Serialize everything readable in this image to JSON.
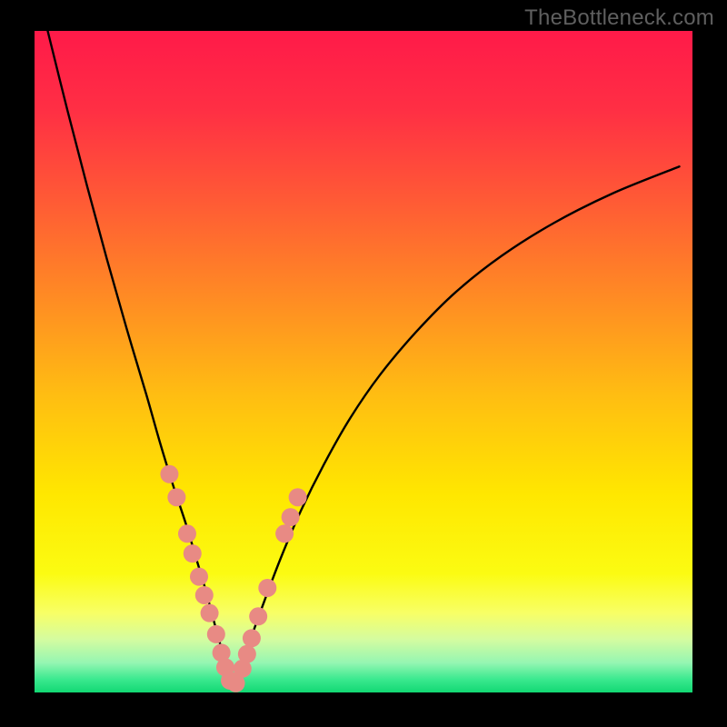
{
  "watermark": "TheBottleneck.com",
  "chart_data": {
    "type": "line",
    "title": "",
    "xlabel": "",
    "ylabel": "",
    "xlim": [
      0,
      100
    ],
    "ylim": [
      0,
      100
    ],
    "background_gradient": {
      "direction": "vertical",
      "stops": [
        {
          "offset": 0.0,
          "color": "#ff1a49"
        },
        {
          "offset": 0.12,
          "color": "#ff2f44"
        },
        {
          "offset": 0.25,
          "color": "#ff5836"
        },
        {
          "offset": 0.4,
          "color": "#ff8a24"
        },
        {
          "offset": 0.55,
          "color": "#ffbd12"
        },
        {
          "offset": 0.7,
          "color": "#ffe700"
        },
        {
          "offset": 0.82,
          "color": "#fbfb12"
        },
        {
          "offset": 0.88,
          "color": "#f8ff66"
        },
        {
          "offset": 0.92,
          "color": "#d4fca0"
        },
        {
          "offset": 0.955,
          "color": "#95f6b2"
        },
        {
          "offset": 0.98,
          "color": "#3be98f"
        },
        {
          "offset": 1.0,
          "color": "#12d873"
        }
      ]
    },
    "series": [
      {
        "name": "left-branch",
        "type": "line",
        "color": "#000000",
        "stroke_width": 2.4,
        "x": [
          2.0,
          5.0,
          8.0,
          11.0,
          14.0,
          17.0,
          19.0,
          21.0,
          23.0,
          24.5,
          26.0,
          27.2,
          28.3,
          29.2,
          30.0
        ],
        "y": [
          100.0,
          88.0,
          76.5,
          65.5,
          55.0,
          45.0,
          38.0,
          31.5,
          25.5,
          20.5,
          15.5,
          11.0,
          7.0,
          3.5,
          0.4
        ]
      },
      {
        "name": "right-branch",
        "type": "line",
        "color": "#000000",
        "stroke_width": 2.4,
        "x": [
          30.0,
          31.5,
          33.0,
          35.0,
          37.5,
          40.5,
          44.0,
          48.0,
          52.5,
          58.0,
          64.0,
          71.0,
          79.0,
          88.0,
          98.0
        ],
        "y": [
          0.4,
          4.0,
          8.5,
          14.0,
          20.5,
          27.5,
          34.5,
          41.5,
          48.0,
          54.5,
          60.5,
          66.0,
          71.0,
          75.5,
          79.5
        ]
      },
      {
        "name": "markers-on-curve",
        "type": "scatter",
        "color": "#e88a84",
        "radius": 10,
        "x": [
          20.5,
          21.6,
          23.2,
          24.0,
          25.0,
          25.8,
          26.6,
          27.6,
          28.4,
          29.0,
          29.7,
          30.6,
          31.6,
          32.3,
          33.0,
          34.0,
          35.4,
          38.0,
          38.9,
          40.0
        ],
        "y": [
          33.0,
          29.5,
          24.0,
          21.0,
          17.5,
          14.7,
          12.0,
          8.8,
          6.0,
          3.8,
          1.8,
          1.4,
          3.6,
          5.8,
          8.2,
          11.5,
          15.8,
          24.0,
          26.5,
          29.5
        ]
      }
    ],
    "curve_minimum_x": 30.0
  }
}
